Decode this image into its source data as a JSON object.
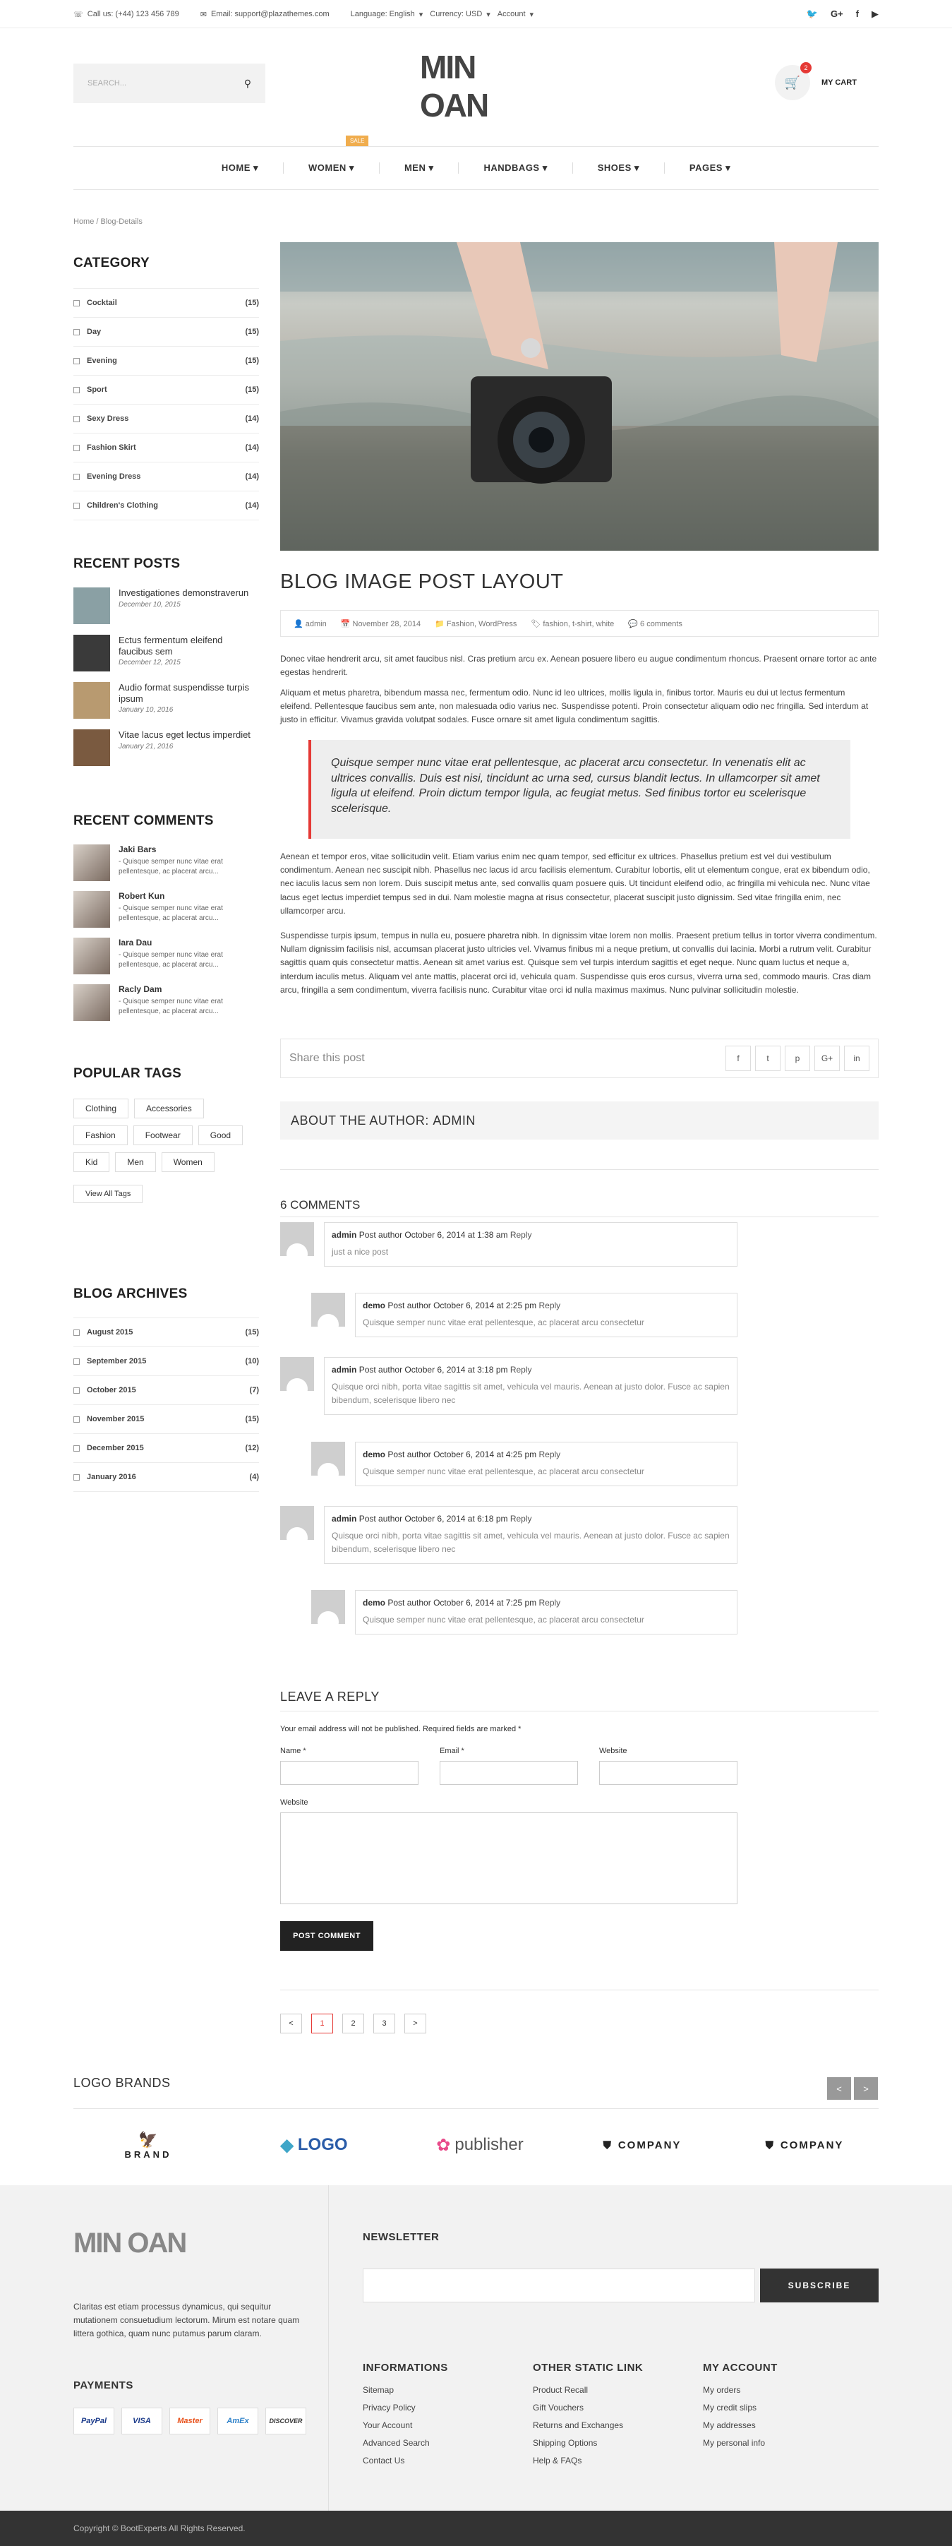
{
  "topbar": {
    "phone": "Call us: (+44) 123 456 789",
    "email": "Email: support@plazathemes.com",
    "language": "Language: English",
    "currency": "Currency: USD",
    "account": "Account"
  },
  "header": {
    "search_placeholder": "SEARCH...",
    "logo": "MIN OAN",
    "cart_label": "MY CART",
    "cart_count": "2"
  },
  "nav": {
    "items": [
      "HOME",
      "WOMEN",
      "MEN",
      "HANDBAGS",
      "SHOES",
      "PAGES"
    ],
    "sale_badge": "SALE"
  },
  "breadcrumb": {
    "home": "Home",
    "sep": "/",
    "current": "Blog-Details"
  },
  "sidebar": {
    "category_title": "CATEGORY",
    "categories": [
      {
        "name": "Cocktail",
        "count": "(15)"
      },
      {
        "name": "Day",
        "count": "(15)"
      },
      {
        "name": "Evening",
        "count": "(15)"
      },
      {
        "name": "Sport",
        "count": "(15)"
      },
      {
        "name": "Sexy Dress",
        "count": "(14)"
      },
      {
        "name": "Fashion Skirt",
        "count": "(14)"
      },
      {
        "name": "Evening Dress",
        "count": "(14)"
      },
      {
        "name": "Children's Clothing",
        "count": "(14)"
      }
    ],
    "recent_posts_title": "RECENT POSTS",
    "recent_posts": [
      {
        "title": "Investigationes demonstraverun",
        "date": "December 10, 2015"
      },
      {
        "title": "Ectus fermentum eleifend faucibus sem",
        "date": "December 12, 2015"
      },
      {
        "title": "Audio format suspendisse turpis ipsum",
        "date": "January 10, 2016"
      },
      {
        "title": "Vitae lacus eget lectus imperdiet",
        "date": "January 21, 2016"
      }
    ],
    "recent_comments_title": "RECENT COMMENTS",
    "recent_comments": [
      {
        "name": "Jaki Bars",
        "text": "- Quisque semper nunc vitae erat pellentesque, ac placerat arcu..."
      },
      {
        "name": "Robert Kun",
        "text": "- Quisque semper nunc vitae erat pellentesque, ac placerat arcu..."
      },
      {
        "name": "Iara Dau",
        "text": "- Quisque semper nunc vitae erat pellentesque, ac placerat arcu..."
      },
      {
        "name": "Racly Dam",
        "text": "- Quisque semper nunc vitae erat pellentesque, ac placerat arcu..."
      }
    ],
    "tags_title": "POPULAR TAGS",
    "tags": [
      "Clothing",
      "Accessories",
      "Fashion",
      "Footwear",
      "Good",
      "Kid",
      "Men",
      "Women"
    ],
    "view_all": "View All Tags",
    "archives_title": "BLOG ARCHIVES",
    "archives": [
      {
        "name": "August 2015",
        "count": "(15)"
      },
      {
        "name": "September 2015",
        "count": "(10)"
      },
      {
        "name": "October 2015",
        "count": "(7)"
      },
      {
        "name": "November 2015",
        "count": "(15)"
      },
      {
        "name": "December 2015",
        "count": "(12)"
      },
      {
        "name": "January 2016",
        "count": "(4)"
      }
    ]
  },
  "post": {
    "title": "BLOG IMAGE POST LAYOUT",
    "author": "admin",
    "date": "November 28, 2014",
    "cats": "Fashion, WordPress",
    "tags": "fashion, t-shirt, white",
    "comments": "6 comments",
    "p1": "Donec vitae hendrerit arcu, sit amet faucibus nisl. Cras pretium arcu ex. Aenean posuere libero eu augue condimentum rhoncus. Praesent ornare tortor ac ante egestas hendrerit.",
    "p2": "Aliquam et metus pharetra, bibendum massa nec, fermentum odio. Nunc id leo ultrices, mollis ligula in, finibus tortor. Mauris eu dui ut lectus fermentum eleifend. Pellentesque faucibus sem ante, non malesuada odio varius nec. Suspendisse potenti. Proin consectetur aliquam odio nec fringilla. Sed interdum at justo in efficitur. Vivamus gravida volutpat sodales. Fusce ornare sit amet ligula condimentum sagittis.",
    "quote": "Quisque semper nunc vitae erat pellentesque, ac placerat arcu consectetur. In venenatis elit ac ultrices convallis. Duis est nisi, tincidunt ac urna sed, cursus blandit lectus. In ullamcorper sit amet ligula ut eleifend. Proin dictum tempor ligula, ac feugiat metus. Sed finibus tortor eu scelerisque scelerisque.",
    "p3": "Aenean et tempor eros, vitae sollicitudin velit. Etiam varius enim nec quam tempor, sed efficitur ex ultrices. Phasellus pretium est vel dui vestibulum condimentum. Aenean nec suscipit nibh. Phasellus nec lacus id arcu facilisis elementum. Curabitur lobortis, elit ut elementum congue, erat ex bibendum odio, nec iaculis lacus sem non lorem. Duis suscipit metus ante, sed convallis quam posuere quis. Ut tincidunt eleifend odio, ac fringilla mi vehicula nec. Nunc vitae lacus eget lectus imperdiet tempus sed in dui. Nam molestie magna at risus consectetur, placerat suscipit justo dignissim. Sed vitae fringilla enim, nec ullamcorper arcu.",
    "p4": "Suspendisse turpis ipsum, tempus in nulla eu, posuere pharetra nibh. In dignissim vitae lorem non mollis. Praesent pretium tellus in tortor viverra condimentum. Nullam dignissim facilisis nisl, accumsan placerat justo ultricies vel. Vivamus finibus mi a neque pretium, ut convallis dui lacinia. Morbi a rutrum velit. Curabitur sagittis quam quis consectetur mattis. Aenean sit amet varius est. Quisque sem vel turpis interdum sagittis et eget neque. Nunc quam luctus et neque a, interdum iaculis metus. Aliquam vel ante mattis, placerat orci id, vehicula quam. Suspendisse quis eros cursus, viverra urna sed, commodo mauris. Cras diam arcu, fringilla a sem condimentum, viverra facilisis nunc. Curabitur vitae orci id nulla maximus maximus. Nunc pulvinar sollicitudin molestie.",
    "share": "Share this post",
    "share_icons": [
      "f",
      "t",
      "p",
      "G+",
      "in"
    ],
    "about": "ABOUT THE AUTHOR:",
    "about_name": "ADMIN"
  },
  "comments": {
    "title": "6 COMMENTS",
    "items": [
      {
        "author": "admin",
        "meta": "Post author October 6, 2014 at 1:38 am",
        "reply": "Reply",
        "text": "just a nice post"
      },
      {
        "author": "demo",
        "meta": "Post author October 6, 2014 at 2:25 pm",
        "reply": "Reply",
        "text": "Quisque semper nunc vitae erat pellentesque, ac placerat arcu consectetur"
      },
      {
        "author": "admin",
        "meta": "Post author October 6, 2014 at 3:18 pm",
        "reply": "Reply",
        "text": "Quisque orci nibh, porta vitae sagittis sit amet, vehicula vel mauris. Aenean at justo dolor. Fusce ac sapien bibendum, scelerisque libero nec"
      },
      {
        "author": "demo",
        "meta": "Post author October 6, 2014 at 4:25 pm",
        "reply": "Reply",
        "text": "Quisque semper nunc vitae erat pellentesque, ac placerat arcu consectetur"
      },
      {
        "author": "admin",
        "meta": "Post author October 6, 2014 at 6:18 pm",
        "reply": "Reply",
        "text": "Quisque orci nibh, porta vitae sagittis sit amet, vehicula vel mauris. Aenean at justo dolor. Fusce ac sapien bibendum, scelerisque libero nec"
      },
      {
        "author": "demo",
        "meta": "Post author October 6, 2014 at 7:25 pm",
        "reply": "Reply",
        "text": "Quisque semper nunc vitae erat pellentesque, ac placerat arcu consectetur"
      }
    ]
  },
  "reply": {
    "title": "LEAVE A REPLY",
    "note": "Your email address will not be published. Required fields are marked *",
    "name": "Name *",
    "email": "Email *",
    "website": "Website",
    "website2": "Website",
    "submit": "POST COMMENT"
  },
  "pagination": [
    "<",
    "1",
    "2",
    "3",
    ">"
  ],
  "brands": {
    "title": "LOGO BRANDS",
    "items": [
      "BRAND",
      "LOGO",
      "publisher",
      "COMPANY",
      "COMPANY"
    ],
    "prev": "<",
    "next": ">"
  },
  "footer": {
    "logo": "MIN OAN",
    "about": "Claritas est etiam processus dynamicus, qui sequitur mutationem consuetudium lectorum. Mirum est notare quam littera gothica, quam nunc putamus parum claram.",
    "payments_title": "PAYMENTS",
    "payments": [
      "PayPal",
      "VISA",
      "Master",
      "AmEx",
      "DISCOVER"
    ],
    "newsletter_title": "NEWSLETTER",
    "subscribe": "SUBSCRIBE",
    "info_title": "INFORMATIONS",
    "info": [
      "Sitemap",
      "Privacy Policy",
      "Your Account",
      "Advanced Search",
      "Contact Us"
    ],
    "static_title": "OTHER STATIC LINK",
    "static": [
      "Product Recall",
      "Gift Vouchers",
      "Returns and Exchanges",
      "Shipping Options",
      "Help & FAQs"
    ],
    "account_title": "MY ACCOUNT",
    "account": [
      "My orders",
      "My credit slips",
      "My addresses",
      "My personal info"
    ],
    "copyright": "Copyright © BootExperts All Rights Reserved.",
    "copyright_brand": "BootExperts"
  }
}
